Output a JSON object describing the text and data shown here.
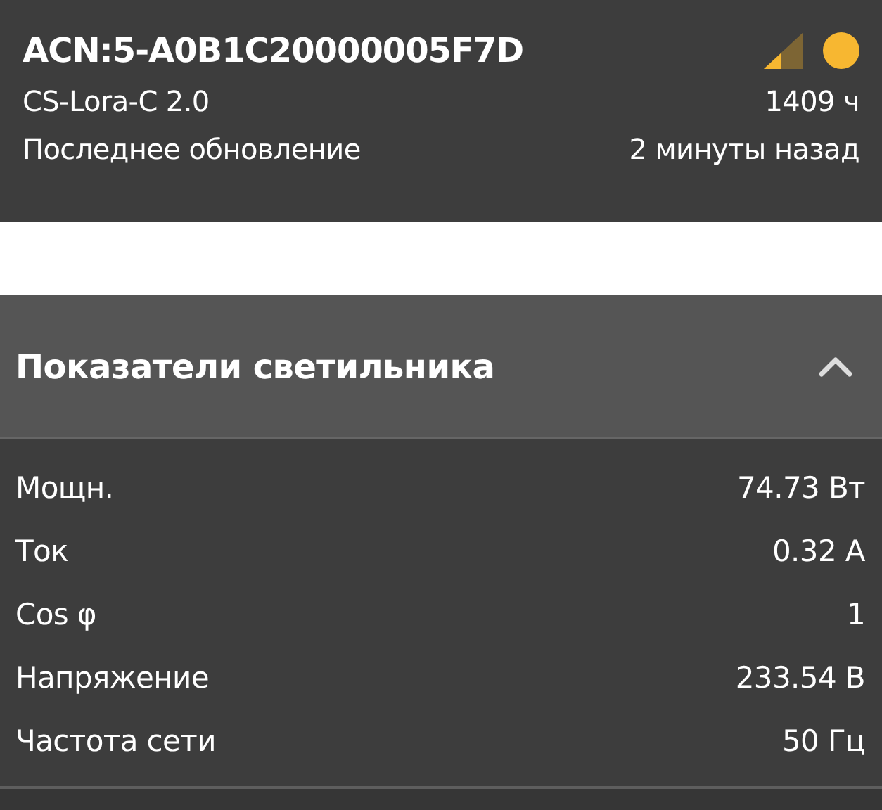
{
  "device": {
    "id": "ACN:5-A0B1C20000005F7D",
    "model": "CS-Lora-C 2.0",
    "hours": "1409 ч",
    "update_label": "Последнее обновление",
    "update_value": "2 минуты назад"
  },
  "section": {
    "title": "Показатели светильника",
    "expanded": true,
    "rows": [
      {
        "label": "Мощн.",
        "value": "74.73 Вт"
      },
      {
        "label": "Ток",
        "value": "0.32 А"
      },
      {
        "label": "Cos φ",
        "value": "1"
      },
      {
        "label": "Напряжение",
        "value": "233.54 В"
      },
      {
        "label": "Частота сети",
        "value": "50 Гц"
      }
    ]
  }
}
